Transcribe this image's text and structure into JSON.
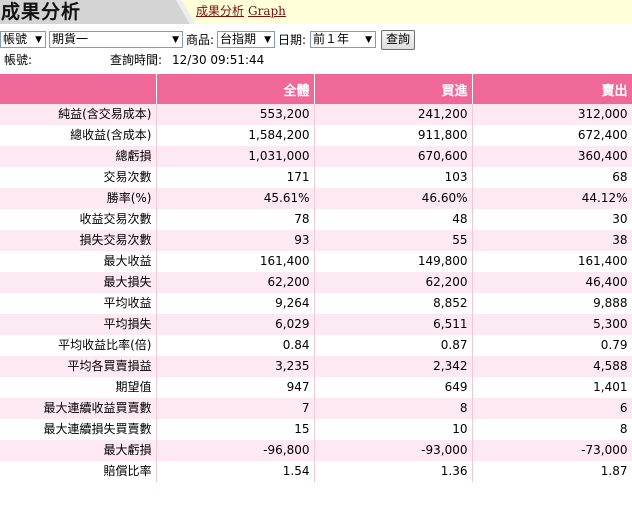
{
  "header": {
    "title": "成果分析",
    "links": [
      "成果分析",
      "Graph"
    ]
  },
  "controls": {
    "account_select": "帳號",
    "type_select": "期貨一",
    "product_label": "商品:",
    "product_select": "台指期",
    "date_label": "日期:",
    "date_select": "前１年",
    "query_button": "查詢"
  },
  "info": {
    "account_label": "帳號:",
    "query_time_label": "查詢時間:",
    "query_time": "12/30 09:51:44"
  },
  "table": {
    "columns": [
      "",
      "全體",
      "買進",
      "賣出"
    ],
    "rows": [
      [
        "純益(含交易成本)",
        "553,200",
        "241,200",
        "312,000"
      ],
      [
        "總收益(含成本)",
        "1,584,200",
        "911,800",
        "672,400"
      ],
      [
        "總虧損",
        "1,031,000",
        "670,600",
        "360,400"
      ],
      [
        "交易次數",
        "171",
        "103",
        "68"
      ],
      [
        "勝率(%)",
        "45.61%",
        "46.60%",
        "44.12%"
      ],
      [
        "收益交易次數",
        "78",
        "48",
        "30"
      ],
      [
        "損失交易次數",
        "93",
        "55",
        "38"
      ],
      [
        "最大收益",
        "161,400",
        "149,800",
        "161,400"
      ],
      [
        "最大損失",
        "62,200",
        "62,200",
        "46,400"
      ],
      [
        "平均收益",
        "9,264",
        "8,852",
        "9,888"
      ],
      [
        "平均損失",
        "6,029",
        "6,511",
        "5,300"
      ],
      [
        "平均收益比率(倍)",
        "0.84",
        "0.87",
        "0.79"
      ],
      [
        "平均各買賣損益",
        "3,235",
        "2,342",
        "4,588"
      ],
      [
        "期望值",
        "947",
        "649",
        "1,401"
      ],
      [
        "最大連續收益買賣數",
        "7",
        "8",
        "6"
      ],
      [
        "最大連續損失買賣數",
        "15",
        "10",
        "8"
      ],
      [
        "最大虧損",
        "-96,800",
        "-93,000",
        "-73,000"
      ],
      [
        "賠償比率",
        "1.54",
        "1.36",
        "1.87"
      ]
    ]
  }
}
